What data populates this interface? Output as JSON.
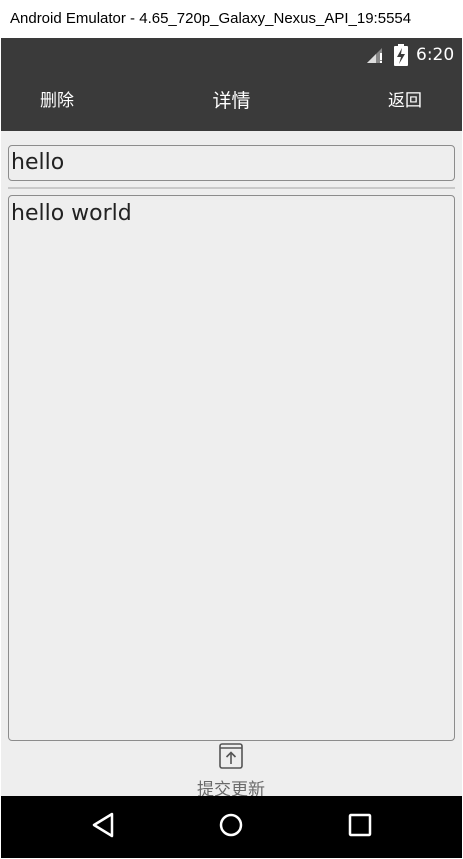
{
  "window": {
    "title": "Android Emulator - 4.65_720p_Galaxy_Nexus_API_19:5554"
  },
  "status_bar": {
    "time": "6:20",
    "signal_icon": "signal-icon",
    "battery_icon": "battery-charging-icon"
  },
  "action_bar": {
    "delete_label": "删除",
    "title": "详情",
    "back_label": "返回",
    "background": "#3a3a3a"
  },
  "form": {
    "title_value": "hello",
    "content_value": "hello world"
  },
  "submit": {
    "label": "提交更新",
    "icon": "upload-icon"
  },
  "nav_bar": {
    "back_icon": "back-triangle-icon",
    "home_icon": "home-circle-icon",
    "recents_icon": "recents-square-icon"
  }
}
